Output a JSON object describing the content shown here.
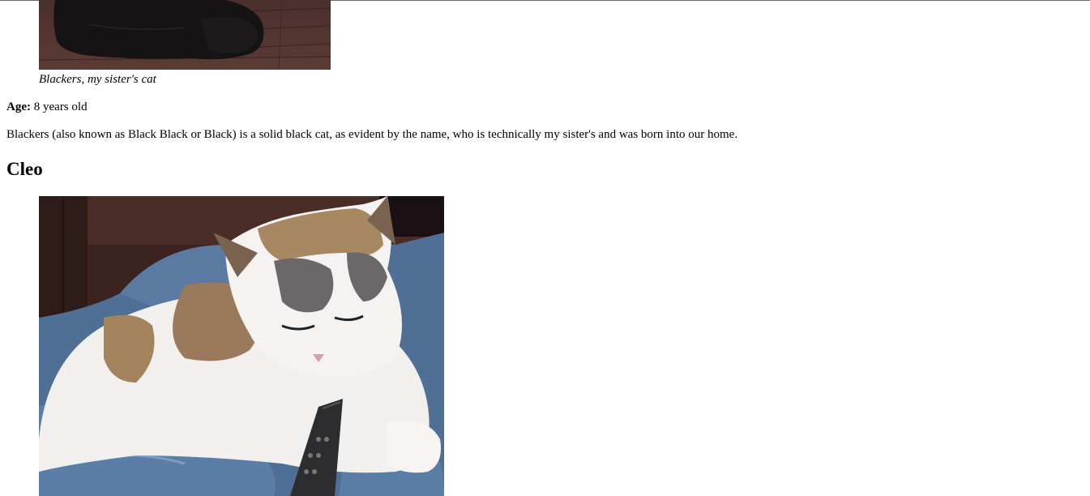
{
  "blackers": {
    "image_alt": "Blackers",
    "caption": "Blackers, my sister's cat",
    "age_label": "Age:",
    "age_value": "8 years old",
    "description": "Blackers (also known as Black Black or Black) is a solid black cat, as evident by the name, who is technically my sister's and was born into our home."
  },
  "cleo": {
    "heading": "Cleo",
    "image_alt": "Cleo"
  }
}
